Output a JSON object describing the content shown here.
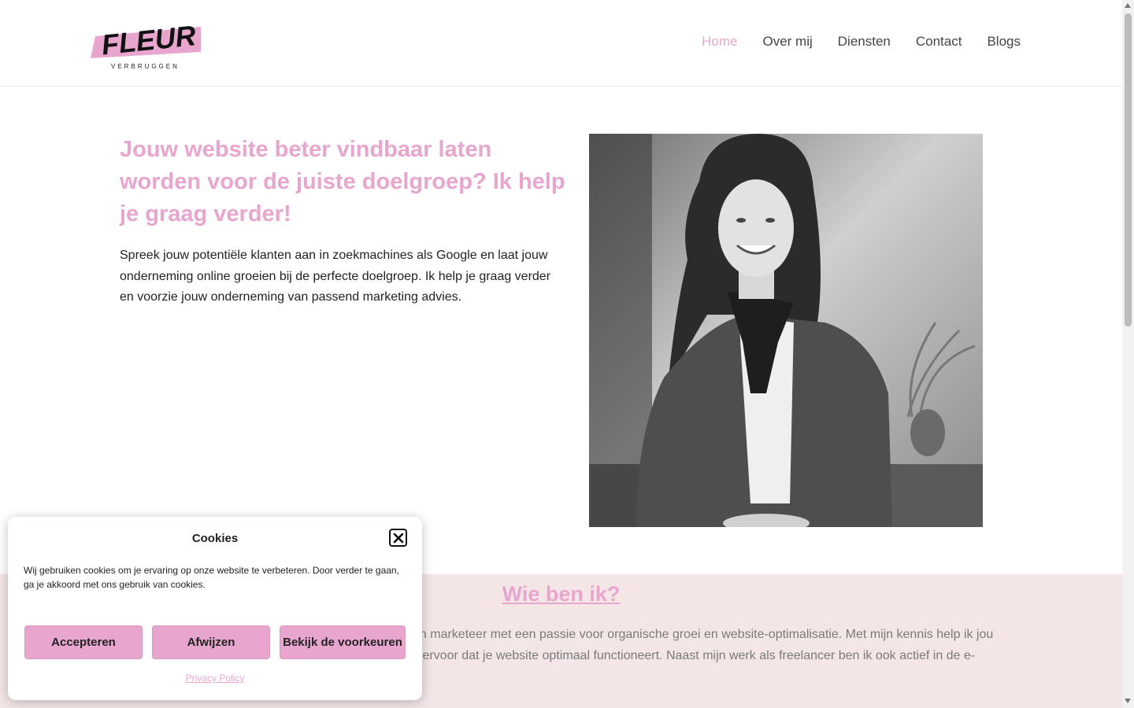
{
  "header": {
    "logo": {
      "name": "FLEUR",
      "tagline": "VERBRUGGEN"
    },
    "nav": [
      {
        "label": "Home",
        "active": true
      },
      {
        "label": "Over mij",
        "active": false
      },
      {
        "label": "Diensten",
        "active": false
      },
      {
        "label": "Contact",
        "active": false
      },
      {
        "label": "Blogs",
        "active": false
      }
    ]
  },
  "hero": {
    "title": "Jouw website beter vindbaar laten worden voor de juiste doelgroep? Ik help je graag verder!",
    "text": "Spreek jouw potentiële klanten aan in zoekmachines als Google en laat jouw onderneming online groeien bij de perfecte doelgroep. Ik help je graag verder en voorzie jouw onderneming van passend marketing advies."
  },
  "about": {
    "title": "Wie ben ik?",
    "text_line1": "en marketeer met een passie voor organische groei en website-optimalisatie. Met mijn kennis help ik jou",
    "text_line2": "k ervoor dat je website optimaal functioneert. Naast mijn werk als freelancer ben ik ook actief in de e-"
  },
  "cookie_banner": {
    "title": "Cookies",
    "text": "Wij gebruiken cookies om je ervaring op onze website te verbeteren. Door verder te gaan, ga je akkoord met ons gebruik van cookies.",
    "accept_label": "Accepteren",
    "deny_label": "Afwijzen",
    "prefs_label": "Bekijk de voorkeuren",
    "privacy_label": "Privacy Policy"
  },
  "colors": {
    "accent_pink": "#e8a6cf",
    "section_bg": "#f4e6e6"
  }
}
